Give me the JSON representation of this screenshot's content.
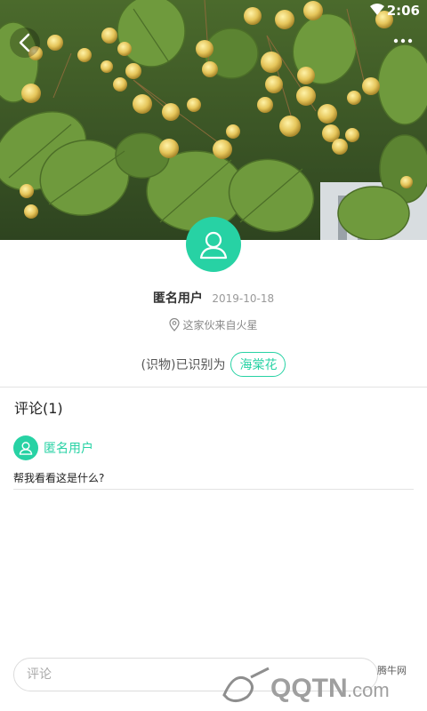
{
  "status_bar": {
    "time": "2:06"
  },
  "nav": {
    "back": "back-icon",
    "more": "more-icon"
  },
  "post": {
    "author": "匿名用户",
    "date": "2019-10-18",
    "location": "这家伙来自火星",
    "identify_prefix": "(识物)已识别为",
    "identified_as": "海棠花"
  },
  "comments": {
    "title": "评论(1)",
    "items": [
      {
        "author": "匿名用户",
        "text": "帮我看看这是什么?"
      }
    ]
  },
  "input": {
    "placeholder": "评论"
  },
  "watermark": {
    "site": "QQTN.com",
    "label": "腾牛网"
  },
  "colors": {
    "accent": "#27d2a4"
  }
}
